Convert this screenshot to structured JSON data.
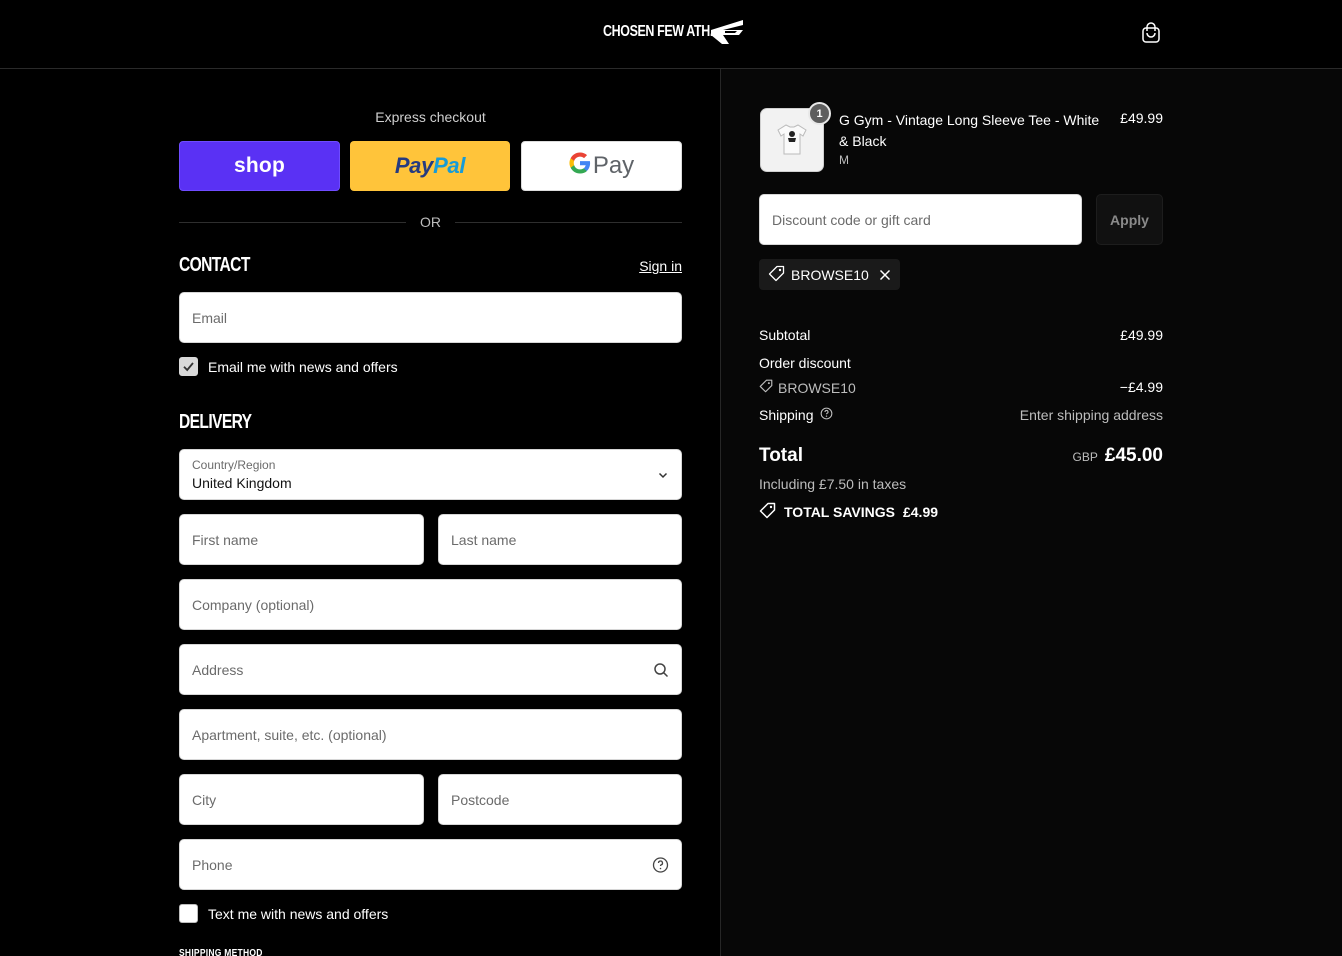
{
  "header": {
    "logo_text": "CHOSEN FEW ATH.",
    "cart_icon": "shopping-bag-icon"
  },
  "express": {
    "title": "Express checkout",
    "shop_label": "shop",
    "paypal_part1": "Pay",
    "paypal_part2": "Pal",
    "gpay_g": "G",
    "gpay_label": "Pay",
    "or_label": "OR"
  },
  "contact": {
    "title": "CONTACT",
    "sign_in": "Sign in",
    "email_placeholder": "Email",
    "news_checkbox_label": "Email me with news and offers",
    "news_checked": true
  },
  "delivery": {
    "title": "DELIVERY",
    "country_label": "Country/Region",
    "country_value": "United Kingdom",
    "first_name": "First name",
    "last_name": "Last name",
    "company": "Company (optional)",
    "address": "Address",
    "apartment": "Apartment, suite, etc. (optional)",
    "city": "City",
    "postcode": "Postcode",
    "phone": "Phone",
    "sms_checkbox_label": "Text me with news and offers",
    "sms_checked": false,
    "next_section": "SHIPPING METHOD"
  },
  "summary": {
    "item": {
      "quantity": "1",
      "name": "G Gym - Vintage Long Sleeve Tee - White & Black",
      "variant": "M",
      "price": "£49.99"
    },
    "discount_placeholder": "Discount code or gift card",
    "apply_label": "Apply",
    "applied_code": "BROWSE10",
    "subtotal_label": "Subtotal",
    "subtotal_value": "£49.99",
    "order_discount_label": "Order discount",
    "discount_code": "BROWSE10",
    "discount_value": "−£4.99",
    "shipping_label": "Shipping",
    "shipping_value": "Enter shipping address",
    "total_label": "Total",
    "currency": "GBP",
    "total_value": "£45.00",
    "taxes": "Including £7.50 in taxes",
    "savings_label": "TOTAL SAVINGS",
    "savings_value": "£4.99"
  },
  "colors": {
    "shop_pay": "#5a31f4",
    "paypal": "#ffc43a",
    "background": "#000000"
  }
}
